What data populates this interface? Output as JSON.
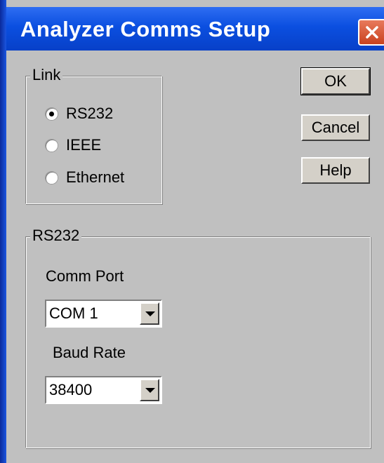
{
  "window": {
    "title": "Analyzer Comms Setup"
  },
  "link_group": {
    "legend": "Link",
    "options": [
      {
        "label": "RS232",
        "checked": true
      },
      {
        "label": "IEEE",
        "checked": false
      },
      {
        "label": "Ethernet",
        "checked": false
      }
    ]
  },
  "buttons": {
    "ok": "OK",
    "cancel": "Cancel",
    "help": "Help"
  },
  "rs232_group": {
    "legend": "RS232",
    "comm_port_label": "Comm Port",
    "comm_port_value": "COM 1",
    "baud_rate_label": "Baud Rate",
    "baud_rate_value": "38400"
  },
  "icons": {
    "close": "close-icon",
    "dropdown": "chevron-down-icon"
  }
}
